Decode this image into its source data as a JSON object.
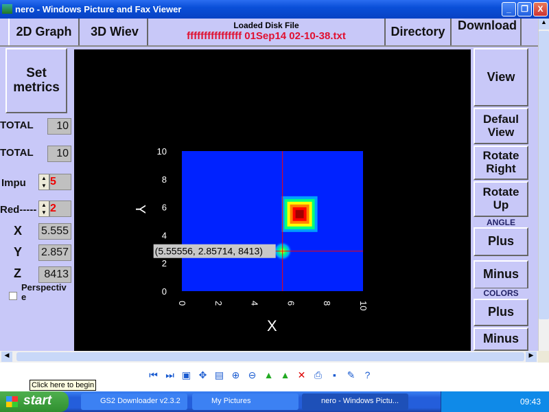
{
  "window": {
    "title": "nero - Windows Picture and Fax Viewer",
    "minimize": "_",
    "restore": "❐",
    "close": "X"
  },
  "toolbar": {
    "graph2d": "2D Graph",
    "view3d": "3D Wiev",
    "loaded_title": "Loaded Disk File",
    "loaded_file": "ffffffffffffffff 01Sep14 02-10-38.txt",
    "directory": "Directory",
    "download": "Download"
  },
  "left": {
    "set_metrics": "Set metrics",
    "total1_label": "TOTAL",
    "total1": "10",
    "total2_label": "TOTAL",
    "total2": "10",
    "impu_label": "Impu",
    "impu": "5",
    "red_label": "Red-----",
    "red": "2",
    "x_label": "X",
    "x": "5.555",
    "y_label": "Y",
    "y": "2.857",
    "z_label": "Z",
    "z": "8413",
    "perspective": "Perspective"
  },
  "right": {
    "view": "View",
    "default_view": "Defaul View",
    "rotate_right": "Rotate Right",
    "rotate_up": "Rotate Up",
    "angle": "ANGLE",
    "angle_plus": "Plus",
    "angle_minus": "Minus",
    "colors": "COLORS",
    "colors_plus": "Plus",
    "colors_minus": "Minus"
  },
  "chart_data": {
    "type": "heatmap",
    "xlabel": "X",
    "ylabel": "Y",
    "xlim": [
      0,
      10
    ],
    "ylim": [
      0,
      10
    ],
    "xticks": [
      "0",
      "2",
      "4",
      "6",
      "8",
      "10"
    ],
    "yticks": [
      "0",
      "2",
      "4",
      "6",
      "8",
      "10"
    ],
    "peaks": [
      {
        "x": 6.5,
        "y": 5.5,
        "level": "max"
      },
      {
        "x": 5.55556,
        "y": 2.85714,
        "level": "low"
      }
    ],
    "cursor": {
      "x": 5.55556,
      "y": 2.85714,
      "z": 8413
    },
    "cursor_label": "(5.55556, 2.85714, 8413)",
    "colors": {
      "background": "#0022ff",
      "crosshair": "#ff0000"
    }
  },
  "viewer": {
    "tooltip": "Click here to begin",
    "icons": [
      "previous-icon",
      "next-icon",
      "best-fit-icon",
      "actual-size-icon",
      "slideshow-icon",
      "zoom-in-icon",
      "zoom-out-icon",
      "rotate-clockwise-icon",
      "rotate-counterclockwise-icon",
      "delete-icon",
      "print-icon",
      "save-icon",
      "edit-icon",
      "help-icon"
    ]
  },
  "taskbar": {
    "start": "start",
    "tasks": [
      "GS2 Downloader v2.3.2",
      "My Pictures",
      "nero - Windows Pictu..."
    ],
    "clock": "09:43"
  }
}
